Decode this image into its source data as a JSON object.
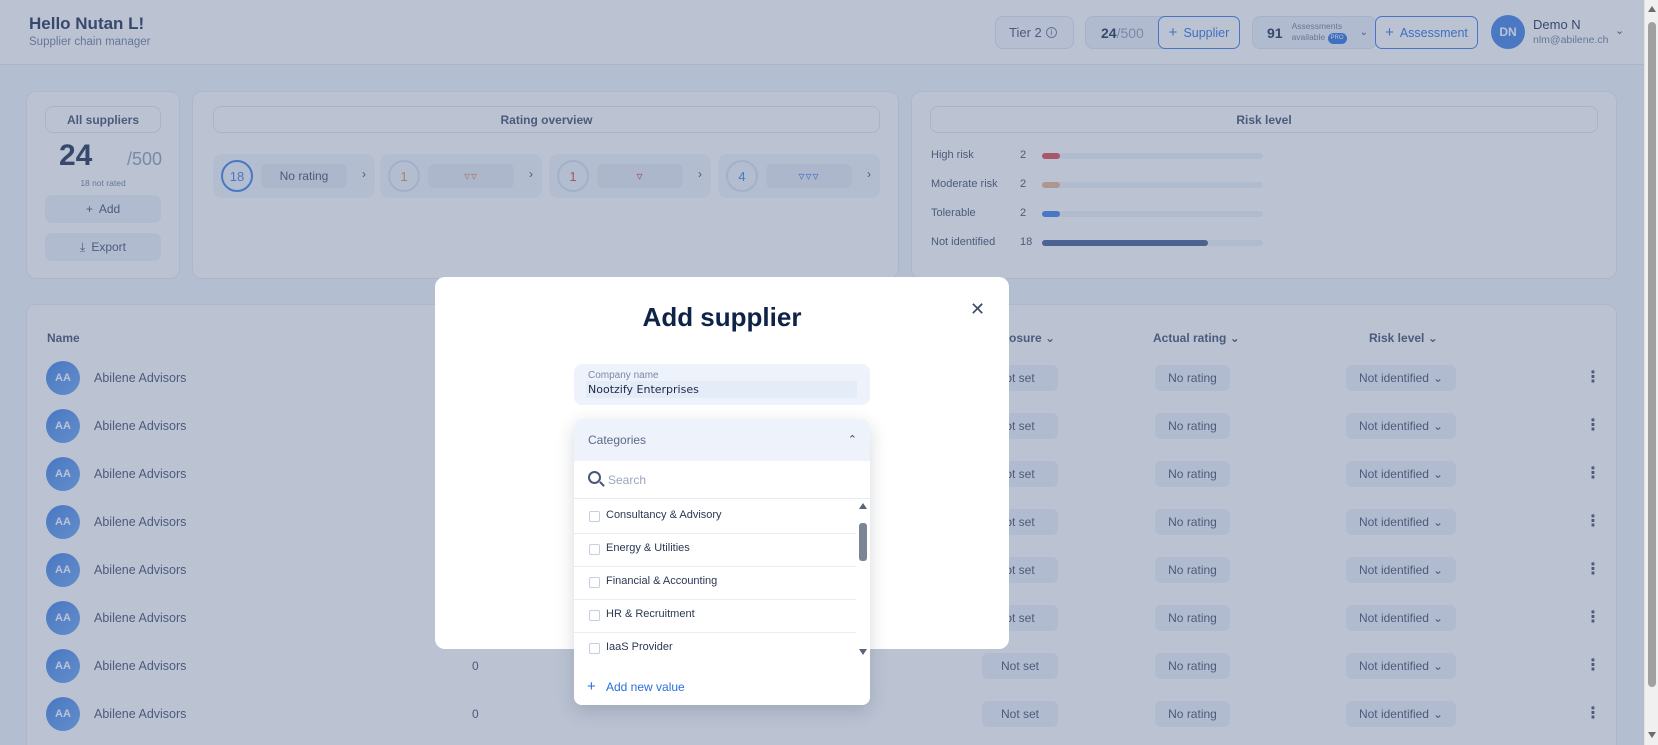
{
  "header": {
    "greeting": "Hello Nutan L!",
    "role": "Supplier chain manager",
    "tier": "Tier 2",
    "info_icon": "info-icon",
    "supplier_count": "24",
    "supplier_max": "/500",
    "add_supplier_label": "Supplier",
    "assessments_count": "91",
    "assessments_label": "Assessments",
    "assessments_sub": "available",
    "pro_badge": "PRO",
    "add_assessment_label": "Assessment",
    "user_initials": "DN",
    "user_name": "Demo N",
    "user_email": "nlm@abilene.ch"
  },
  "summary": {
    "title": "All suppliers",
    "count": "24",
    "max": "/500",
    "not_rated": "18 not rated",
    "add_label": "Add",
    "export_label": "Export"
  },
  "rating_overview": {
    "title": "Rating overview",
    "cards": [
      {
        "count": "18",
        "label": "No rating",
        "color": "#3b7de4"
      },
      {
        "count": "1",
        "label": "",
        "color": "#e38a4a"
      },
      {
        "count": "1",
        "label": "",
        "color": "#d64545"
      },
      {
        "count": "4",
        "label": "",
        "color": "#3b7de4"
      }
    ]
  },
  "risk_level": {
    "title": "Risk level",
    "rows": [
      {
        "label": "High risk",
        "value": "2",
        "fraction": 0.083,
        "color": "#e0484f"
      },
      {
        "label": "Moderate risk",
        "value": "2",
        "fraction": 0.083,
        "color": "#e7b48c"
      },
      {
        "label": "Tolerable",
        "value": "2",
        "fraction": 0.083,
        "color": "#3b7de4"
      },
      {
        "label": "Not identified",
        "value": "18",
        "fraction": 0.75,
        "color": "#3d5a8c"
      }
    ]
  },
  "table": {
    "columns": {
      "name": "Name",
      "disclosure": "osure",
      "actual_rating": "Actual rating",
      "risk_level": "Risk level"
    },
    "rows": [
      {
        "initials": "AA",
        "name": "Abilene Advisors",
        "count": "",
        "disclosure": "ot set",
        "rating": "No rating",
        "risk": "Not identified"
      },
      {
        "initials": "AA",
        "name": "Abilene Advisors",
        "count": "",
        "disclosure": "ot set",
        "rating": "No rating",
        "risk": "Not identified"
      },
      {
        "initials": "AA",
        "name": "Abilene Advisors",
        "count": "",
        "disclosure": "ot set",
        "rating": "No rating",
        "risk": "Not identified"
      },
      {
        "initials": "AA",
        "name": "Abilene Advisors",
        "count": "",
        "disclosure": "ot set",
        "rating": "No rating",
        "risk": "Not identified"
      },
      {
        "initials": "AA",
        "name": "Abilene Advisors",
        "count": "",
        "disclosure": "ot set",
        "rating": "No rating",
        "risk": "Not identified"
      },
      {
        "initials": "AA",
        "name": "Abilene Advisors",
        "count": "",
        "disclosure": "ot set",
        "rating": "No rating",
        "risk": "Not identified"
      },
      {
        "initials": "AA",
        "name": "Abilene Advisors",
        "count": "0",
        "disclosure": "Not set",
        "rating": "No rating",
        "risk": "Not identified"
      },
      {
        "initials": "AA",
        "name": "Abilene Advisors",
        "count": "0",
        "disclosure": "Not set",
        "rating": "No rating",
        "risk": "Not identified"
      }
    ]
  },
  "modal": {
    "title": "Add supplier",
    "close_icon": "close-icon",
    "company_name_label": "Company name",
    "company_name_value": "Nootzify Enterprises",
    "categories_label": "Categories",
    "search_placeholder": "Search",
    "categories": [
      {
        "label": "Consultancy & Advisory",
        "checked": false
      },
      {
        "label": "Energy & Utilities",
        "checked": false
      },
      {
        "label": "Financial & Accounting",
        "checked": false
      },
      {
        "label": "HR & Recruitment",
        "checked": false
      },
      {
        "label": "IaaS Provider",
        "checked": false
      }
    ],
    "add_new_value": "Add new value"
  }
}
